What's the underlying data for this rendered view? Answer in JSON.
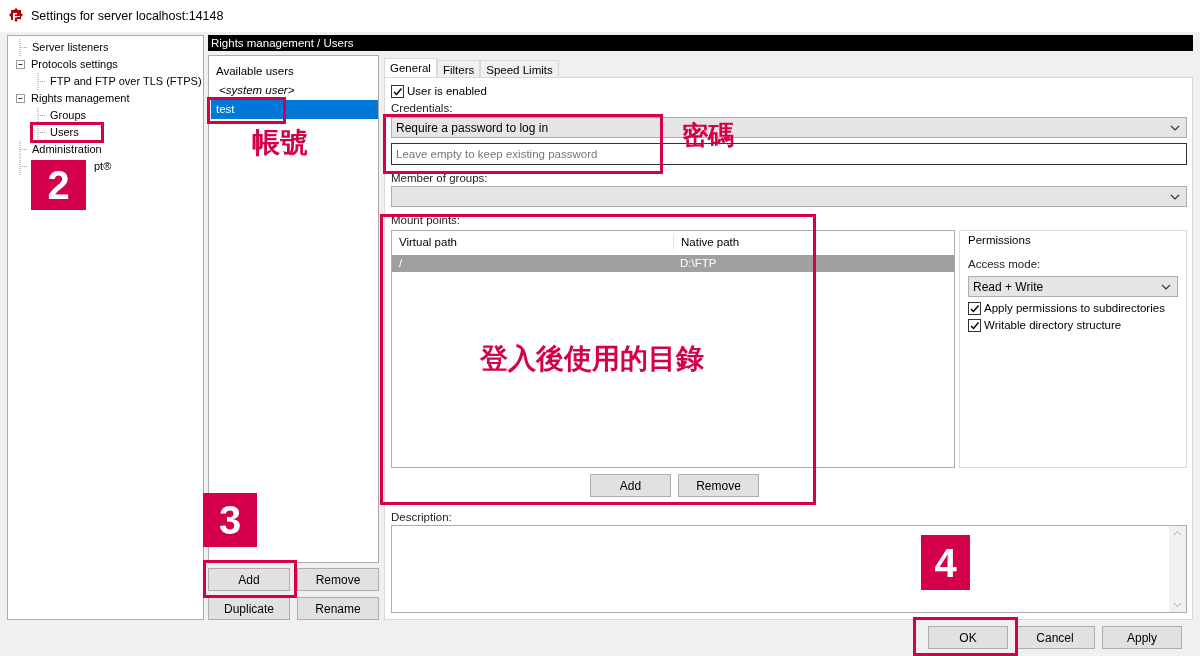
{
  "window": {
    "title": "Settings for server localhost:14148"
  },
  "tree": [
    {
      "label": "Server listeners",
      "selected": false
    },
    {
      "label": "Protocols settings",
      "selected": false,
      "expanded": true,
      "children": [
        {
          "label": "FTP and FTP over TLS (FTPS)",
          "selected": false
        }
      ]
    },
    {
      "label": "Rights management",
      "selected": false,
      "expanded": true,
      "children": [
        {
          "label": "Groups",
          "selected": false
        },
        {
          "label": "Users",
          "selected": false
        }
      ]
    },
    {
      "label": "Administration",
      "selected": false
    },
    {
      "label": "pt®",
      "selected": false,
      "kind": "partial"
    }
  ],
  "breadcrumb": "Rights management / Users",
  "users": {
    "heading": "Available users",
    "items": [
      {
        "label": "<system user>",
        "kind": "system",
        "selected": false
      },
      {
        "label": "test",
        "kind": "user",
        "selected": true
      }
    ]
  },
  "user_buttons": [
    "Add",
    "Remove",
    "Duplicate",
    "Rename"
  ],
  "tabs": [
    {
      "label": "General",
      "selected": true
    },
    {
      "label": "Filters",
      "selected": false
    },
    {
      "label": "Speed Limits",
      "selected": false
    }
  ],
  "general": {
    "enabled": {
      "label": "User is enabled",
      "checked": true
    },
    "credentials_label": "Credentials:",
    "credentials_select": "Require a password to log in",
    "password": {
      "placeholder": "Leave empty to keep existing password"
    },
    "groups_label": "Member of groups:",
    "mount_label": "Mount points:",
    "mount_columns": [
      "Virtual path",
      "Native path"
    ],
    "mount_rows": [
      {
        "cells": [
          "/",
          "D:\\FTP"
        ],
        "selected": true
      }
    ],
    "mount_buttons": [
      "Add",
      "Remove"
    ],
    "permissions": {
      "title": "Permissions",
      "access_label": "Access mode:",
      "access_select": "Read + Write",
      "options": [
        {
          "label": "Apply permissions to subdirectories",
          "checked": true
        },
        {
          "label": "Writable directory structure",
          "checked": true
        }
      ]
    },
    "description_label": "Description:"
  },
  "dialog_buttons": [
    "OK",
    "Cancel",
    "Apply"
  ],
  "annotations": [
    {
      "kind": "badge",
      "text": "2"
    },
    {
      "kind": "badge",
      "text": "3"
    },
    {
      "kind": "badge",
      "text": "4"
    },
    {
      "kind": "label",
      "text": "帳號"
    },
    {
      "kind": "label",
      "text": "密碼"
    },
    {
      "kind": "label",
      "text": "登入後使用的目錄"
    }
  ]
}
